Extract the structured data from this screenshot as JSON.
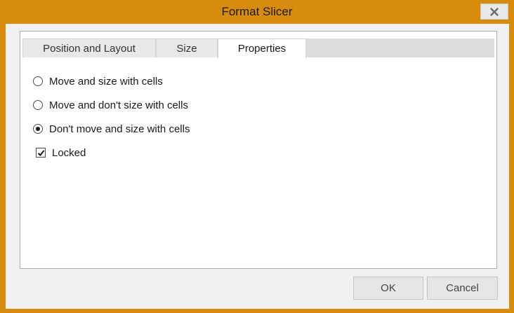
{
  "window": {
    "title": "Format Slicer",
    "frame_color": "#d88c0d",
    "close_icon": "close-icon"
  },
  "tabs": [
    {
      "label": "Position and Layout",
      "active": false
    },
    {
      "label": "Size",
      "active": false
    },
    {
      "label": "Properties",
      "active": true
    }
  ],
  "properties": {
    "options": [
      {
        "label": "Move and size with cells",
        "selected": false
      },
      {
        "label": "Move and don't size with cells",
        "selected": false
      },
      {
        "label": "Don't move and size with cells",
        "selected": true
      }
    ],
    "locked": {
      "label": "Locked",
      "checked": true
    }
  },
  "buttons": {
    "ok": "OK",
    "cancel": "Cancel"
  }
}
